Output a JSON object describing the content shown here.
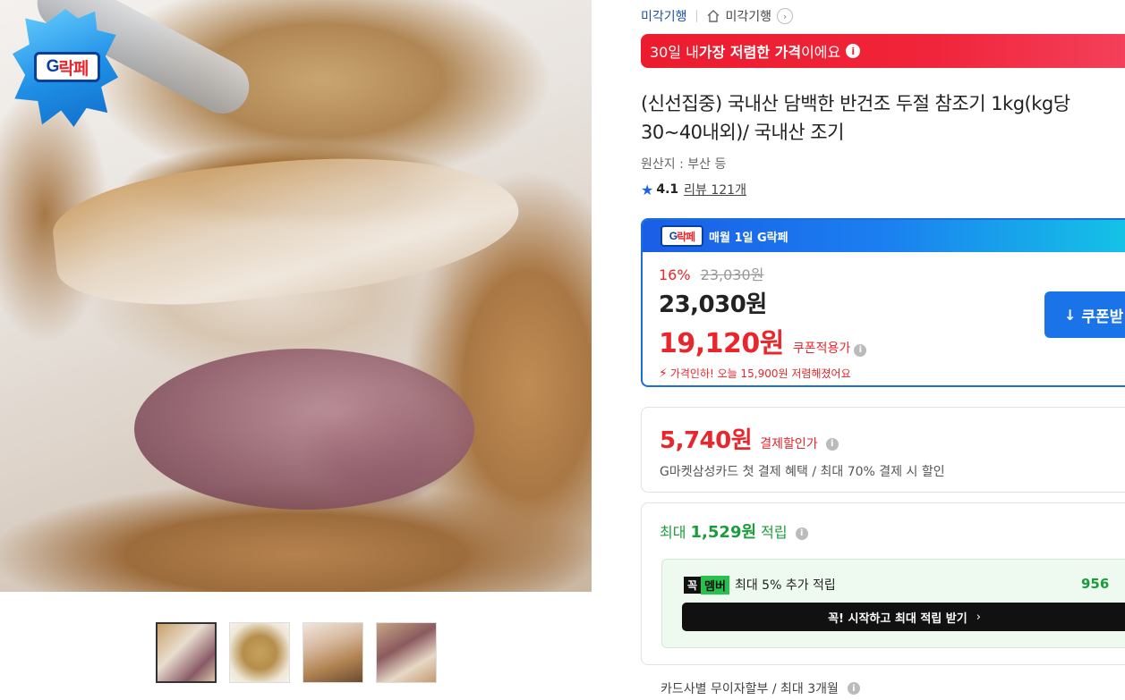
{
  "image": {
    "badge_text_left": "G",
    "badge_text_right": "락페",
    "thumbnails": [
      "thumb-1",
      "thumb-2",
      "thumb-3",
      "thumb-4"
    ]
  },
  "breadcrumb": {
    "seller": "미각기행",
    "home_label": "미각기행",
    "arrow": "›"
  },
  "price_banner": {
    "prefix": "30일 내 ",
    "bold": "가장 저렴한 가격",
    "suffix": "이에요"
  },
  "product": {
    "title": "(신선집중) 국내산 담백한 반건조 두절 참조기 1kg(kg당 30~40내외)/ 국내산 조기",
    "origin": "원산지 : 부산 등",
    "rating": "4.1",
    "review_link": "리뷰 121개"
  },
  "deal": {
    "logo_left": "G",
    "logo_right": "락페",
    "header": "매월 1일 G락페",
    "discount_pct": "16%",
    "original_price": "23,030원",
    "price": "23,030원",
    "coupon_price": "19,120원",
    "coupon_label": "쿠폰적용가",
    "price_drop_notice": "가격인하! 오늘 15,900원 저렴해졌어요",
    "coupon_button": "쿠폰받"
  },
  "card_discount": {
    "price": "5,740원",
    "label": "결제할인가",
    "description": "G마켓삼성카드 첫 결제 혜택 / 최대 70% 결제 시 할인"
  },
  "points": {
    "prefix": "최대 ",
    "amount": "1,529원",
    "suffix": " 적립",
    "member_logo_left": "꼭",
    "member_logo_right": "멤버",
    "member_text": "최대 5% 추가 적립",
    "member_points": "956",
    "member_cta": "꼭! 시작하고 최대 적립 받기"
  },
  "installment": "카드사별 무이자할부 / 최대 3개월",
  "colors": {
    "accent_red": "#e8262c",
    "accent_blue": "#1a74e8",
    "accent_green": "#1b9c3a"
  }
}
